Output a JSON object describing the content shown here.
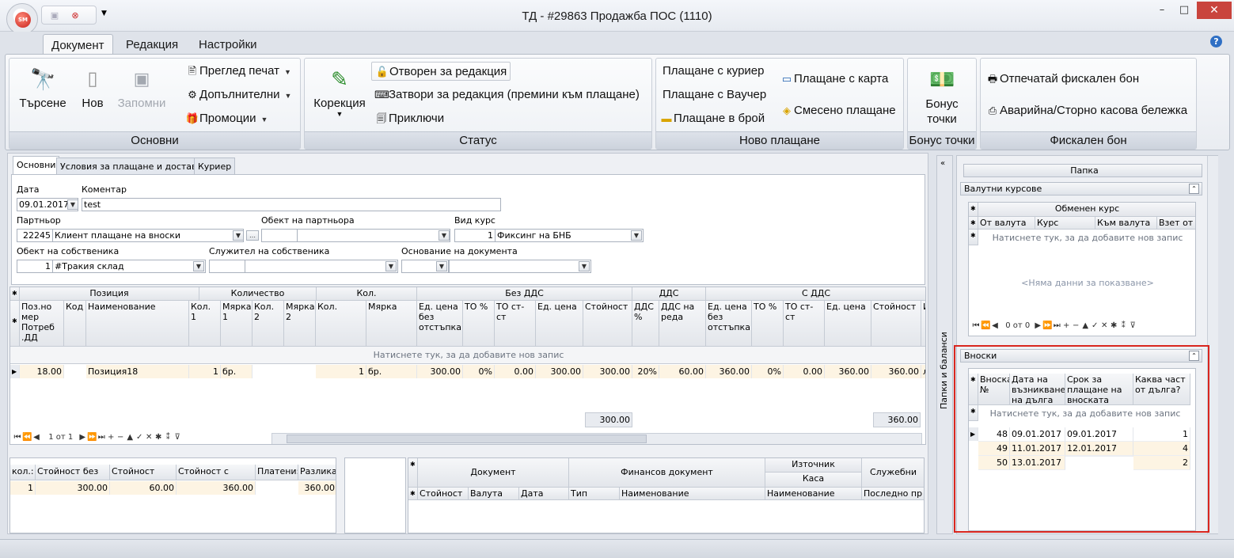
{
  "window": {
    "title": "ТД - #29863 Продажба ПОС (1110)",
    "logo_text": "SM"
  },
  "ribbon_tabs": [
    "Документ",
    "Редакция",
    "Настройки"
  ],
  "ribbon": {
    "osnovni": {
      "label": "Основни",
      "search": "Търсене",
      "new": "Нов",
      "save": "Запомни",
      "print_preview": "Преглед печат",
      "additional": "Допълнителни",
      "promotions": "Промоции"
    },
    "status": {
      "label": "Статус",
      "correction": "Корекция",
      "open_edit": "Отворен за редакция",
      "close_edit": "Затвори за редакция (премини към плащане)",
      "finish": "Приключи"
    },
    "payment": {
      "label": "Ново плащане",
      "courier": "Плащане с куриер",
      "voucher": "Плащане с Ваучер",
      "cash": "Плащане в брой",
      "card": "Плащане с карта",
      "mixed": "Смесено плащане"
    },
    "bonus": {
      "label": "Бонус точки",
      "btn_line1": "Бонус",
      "btn_line2": "точки"
    },
    "fiscal": {
      "label": "Фискален бон",
      "print": "Отпечатай фискален бон",
      "storno": "Аварийна/Сторно касова бележка"
    }
  },
  "doc_tabs": [
    "Основни",
    "Условия за плащане и доставка",
    "Куриер"
  ],
  "form": {
    "date_label": "Дата",
    "date": "09.01.2017",
    "comment_label": "Коментар",
    "comment": "test",
    "partner_label": "Партньор",
    "partner_code": "22245",
    "partner_name": "Клиент плащане на вноски",
    "partner_object_label": "Обект на партньора",
    "rate_label": "Вид курс",
    "rate_code": "1",
    "rate_name": "Фиксинг на БНБ",
    "own_object_label": "Обект на собственика",
    "own_object_code": "1",
    "own_object_name": "#Тракия склад",
    "employee_label": "Служител на собственика",
    "basis_label": "Основание на документа"
  },
  "items_grid": {
    "group_headers": [
      "Позиция",
      "Количество",
      "Кол.",
      "Без ДДС",
      "ДДС",
      "С ДДС"
    ],
    "columns": [
      "Поз.но мер Потреб .ДД",
      "Код",
      "Наименование",
      "Кол. 1",
      "Мярка 1",
      "Кол. 2",
      "Мярка 2",
      "Кол.",
      "Мярка",
      "Ед. цена без отстъпка",
      "ТО %",
      "ТО ст-ст",
      "Ед. цена",
      "Стойност",
      "ДДС %",
      "ДДС на реда",
      "Ед. цена без отстъпка",
      "ТО %",
      "ТО ст-ст",
      "Ед. цена",
      "Стойност",
      "И"
    ],
    "new_row_hint": "Натиснете тук, за да добавите нов запис",
    "rows": [
      [
        "18.00",
        "",
        "Позиция18",
        "1",
        "бр.",
        "",
        "",
        "1",
        "бр.",
        "300.00",
        "0%",
        "0.00",
        "300.00",
        "300.00",
        "20%",
        "60.00",
        "360.00",
        "0%",
        "0.00",
        "360.00",
        "360.00",
        "л"
      ]
    ],
    "totals": {
      "without_vat": "300.00",
      "with_vat": "360.00"
    },
    "nav_text": "1 от 1"
  },
  "summary": {
    "headers": [
      "кол.:",
      "Стойност без ДДС:",
      "Стойност ДДС:",
      "Стойност с ДДС:",
      "Платени:",
      "Разлика:"
    ],
    "values": [
      "1",
      "300.00",
      "60.00",
      "360.00",
      "",
      "360.00"
    ]
  },
  "payments_grid": {
    "group_headers": [
      "Документ",
      "Финансов документ",
      "Източник",
      "Каса",
      "Служебни"
    ],
    "columns": [
      "Стойност",
      "Валута",
      "Дата",
      "Тип",
      "Наименование",
      "Наименование",
      "Последно пр"
    ]
  },
  "side_strip_label": "Папки и баланси",
  "right": {
    "folder_button": "Папка",
    "currency_panel": {
      "title": "Валутни курсове",
      "group_header": "Обменен курс",
      "columns": [
        "От валута",
        "Курс",
        "Към валута",
        "Взет от"
      ],
      "new_row_hint": "Натиснете тук, за да добавите нов запис",
      "empty": "<Няма данни за показване>",
      "nav_text": "0 от 0"
    },
    "installments_panel": {
      "title": "Вноски",
      "columns": [
        "Вноска №",
        "Дата на възникване на дълга",
        "Срок за плащане на вноската",
        "Каква част от дълга?"
      ],
      "new_row_hint": "Натиснете тук, за да добавите нов запис",
      "rows": [
        [
          "48",
          "09.01.2017",
          "09.01.2017",
          "1"
        ],
        [
          "49",
          "11.01.2017",
          "12.01.2017",
          "4"
        ],
        [
          "50",
          "13.01.2017",
          "",
          "2"
        ]
      ]
    }
  },
  "colors": {
    "highlight_box": "#d9261f",
    "selected_row": "#fdf4e3"
  }
}
